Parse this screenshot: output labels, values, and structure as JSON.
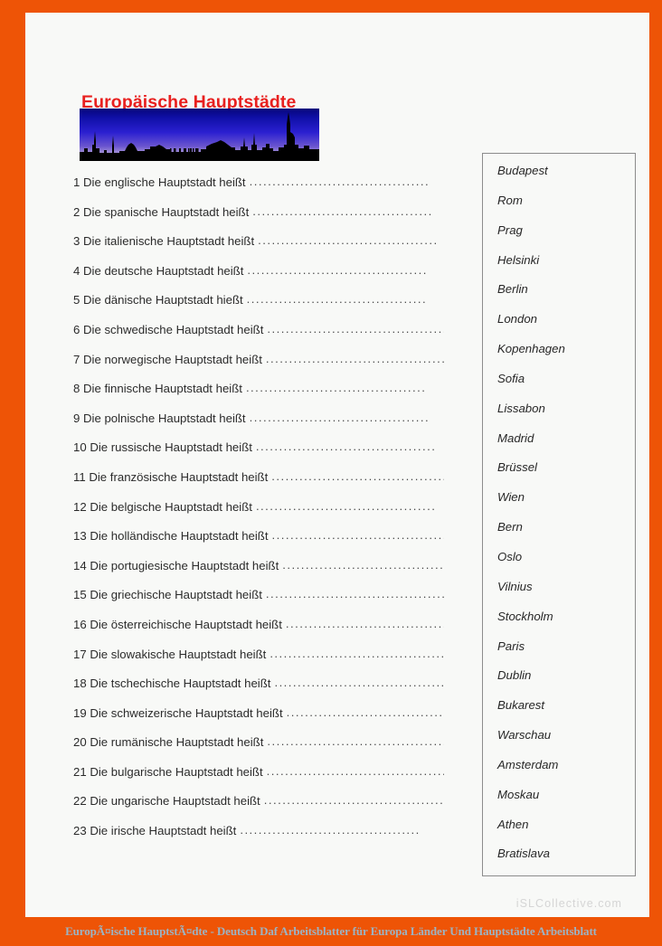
{
  "page": {
    "title": "Europäische Hauptstädte",
    "border_color": "#ee5406",
    "title_color": "#e8201f",
    "sheet_color": "#f8f9f7"
  },
  "illustration": {
    "name": "berlin-skyline-silhouette",
    "sky_top_color": "#06067a",
    "sky_mid_color": "#2a1fd0",
    "sky_bottom_color": "#b9a8d8",
    "silhouette_color": "#000000"
  },
  "questions": [
    {
      "number": "1",
      "text": "1 Die englische Hauptstadt heißt",
      "leader": "......................................."
    },
    {
      "number": "2",
      "text": "2 Die spanische Hauptstadt heißt",
      "leader": "......................................."
    },
    {
      "number": "3",
      "text": "3 Die italienische Hauptstadt heißt",
      "leader": "......................................."
    },
    {
      "number": "4",
      "text": "4 Die deutsche Hauptstadt heißt",
      "leader": "......................................."
    },
    {
      "number": "5",
      "text": "5 Die dänische Hauptstadt hießt",
      "leader": "......................................."
    },
    {
      "number": "6",
      "text": "6 Die schwedische Hauptstadt heißt",
      "leader": "......................................."
    },
    {
      "number": "7",
      "text": "7 Die norwegische Hauptstadt heißt",
      "leader": "......................................."
    },
    {
      "number": "8",
      "text": "8 Die finnische Hauptstadt heißt",
      "leader": "......................................."
    },
    {
      "number": "9",
      "text": "9 Die polnische Hauptstadt heißt",
      "leader": "......................................."
    },
    {
      "number": "10",
      "text": "10 Die russische Hauptstadt heißt",
      "leader": "......................................."
    },
    {
      "number": "11",
      "text": "11 Die französische Hauptstadt heißt",
      "leader": "......................................."
    },
    {
      "number": "12",
      "text": "12 Die belgische Hauptstadt heißt",
      "leader": "......................................."
    },
    {
      "number": "13",
      "text": "13 Die holländische Hauptstadt heißt",
      "leader": "......................................."
    },
    {
      "number": "14",
      "text": "14 Die portugiesische Hauptstadt heißt",
      "leader": "......................................."
    },
    {
      "number": "15",
      "text": "15 Die griechische Hauptstadt heißt",
      "leader": "......................................."
    },
    {
      "number": "16",
      "text": "16 Die österreichische Hauptstadt heißt",
      "leader": "......................................."
    },
    {
      "number": "17",
      "text": "17 Die slowakische Hauptstadt heißt",
      "leader": "......................................."
    },
    {
      "number": "18",
      "text": "18 Die tschechische Hauptstadt heißt",
      "leader": "......................................."
    },
    {
      "number": "19",
      "text": "19 Die schweizerische Hauptstadt heißt",
      "leader": "......................................."
    },
    {
      "number": "20",
      "text": "20 Die rumänische Hauptstadt heißt",
      "leader": "......................................."
    },
    {
      "number": "21",
      "text": "21 Die bulgarische Hauptstadt heißt",
      "leader": "......................................."
    },
    {
      "number": "22",
      "text": "22 Die ungarische Hauptstadt heißt",
      "leader": "......................................."
    },
    {
      "number": "23",
      "text": "23 Die irische Hauptstadt heißt",
      "leader": "......................................."
    }
  ],
  "word_bank": {
    "border_color": "#8c8c8c",
    "items": [
      "Budapest",
      "Rom",
      "Prag",
      "Helsinki",
      "Berlin",
      "London",
      "Kopenhagen",
      "Sofia",
      "Lissabon",
      "Madrid",
      "Brüssel",
      "Wien",
      "Bern",
      "Oslo",
      "Vilnius",
      "Stockholm",
      "Paris",
      "Dublin",
      "Bukarest",
      "Warschau",
      "Amsterdam",
      "Moskau",
      "Athen",
      "Bratislava"
    ]
  },
  "watermark": {
    "text": "iSLCollective.com",
    "color": "#d5d5d5"
  },
  "caption": {
    "text": "EuropÃ¤ische HauptstÃ¤dte - Deutsch Daf Arbeitsblatter für Europa Länder Und Hauptstädte Arbeitsblatt",
    "bar_color": "#ee5406",
    "text_color": "#9bb4c4"
  }
}
